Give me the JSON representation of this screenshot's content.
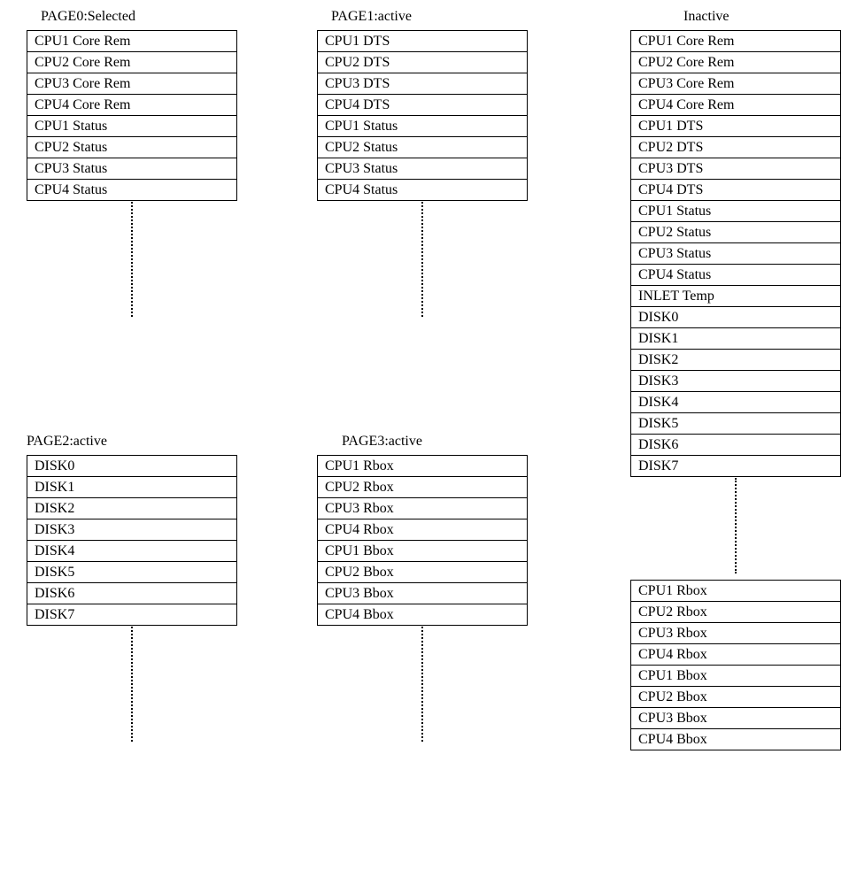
{
  "panels": {
    "page0": {
      "title": "PAGE0:Selected",
      "items": [
        "CPU1 Core Rem",
        "CPU2 Core Rem",
        "CPU3 Core Rem",
        "CPU4 Core Rem",
        "CPU1 Status",
        "CPU2 Status",
        "CPU3 Status",
        "CPU4 Status"
      ]
    },
    "page1": {
      "title": "PAGE1:active",
      "items": [
        "CPU1 DTS",
        "CPU2 DTS",
        "CPU3 DTS",
        "CPU4 DTS",
        "CPU1 Status",
        "CPU2 Status",
        "CPU3 Status",
        "CPU4 Status"
      ]
    },
    "inactive_top": {
      "title": "Inactive",
      "items": [
        "CPU1 Core Rem",
        "CPU2 Core Rem",
        "CPU3 Core Rem",
        "CPU4 Core Rem",
        "CPU1 DTS",
        "CPU2 DTS",
        "CPU3 DTS",
        "CPU4 DTS",
        "CPU1 Status",
        "CPU2 Status",
        "CPU3 Status",
        "CPU4 Status",
        "INLET Temp",
        "DISK0",
        "DISK1",
        "DISK2",
        "DISK3",
        "DISK4",
        "DISK5",
        "DISK6",
        "DISK7"
      ]
    },
    "page2": {
      "title": "PAGE2:active",
      "items": [
        "DISK0",
        "DISK1",
        "DISK2",
        "DISK3",
        "DISK4",
        "DISK5",
        "DISK6",
        "DISK7"
      ]
    },
    "page3": {
      "title": "PAGE3:active",
      "items": [
        "CPU1 Rbox",
        "CPU2 Rbox",
        "CPU3 Rbox",
        "CPU4 Rbox",
        "CPU1 Bbox",
        "CPU2 Bbox",
        "CPU3 Bbox",
        "CPU4 Bbox"
      ]
    },
    "inactive_bottom": {
      "title": "",
      "items": [
        "CPU1 Rbox",
        "CPU2 Rbox",
        "CPU3 Rbox",
        "CPU4 Rbox",
        "CPU1 Bbox",
        "CPU2 Bbox",
        "CPU3 Bbox",
        "CPU4 Bbox"
      ]
    }
  }
}
